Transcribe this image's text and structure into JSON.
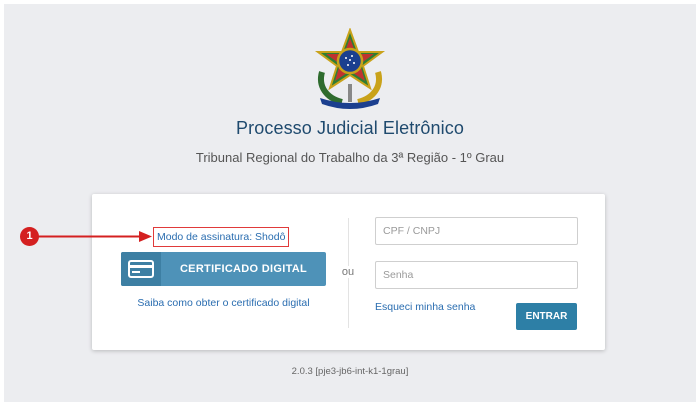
{
  "header": {
    "title": "Processo Judicial Eletrônico",
    "subtitle": "Tribunal Regional do Trabalho da 3ª Região - 1º Grau"
  },
  "certificate": {
    "mode_label": "Modo de assinatura: Shodô",
    "button_label": "CERTIFICADO DIGITAL",
    "help_link": "Saiba como obter o certificado digital"
  },
  "separator_text": "ou",
  "login": {
    "cpf_placeholder": "CPF / CNPJ",
    "password_placeholder": "Senha",
    "forgot_link": "Esqueci minha senha",
    "submit_label": "ENTRAR"
  },
  "footer": {
    "version": "2.0.3 [pje3-jb6-int-k1-1grau]"
  },
  "annotation": {
    "marker": "1",
    "color": "#d42020"
  },
  "colors": {
    "title": "#1f4a6e",
    "primary_button": "#4e92b8",
    "submit_button": "#2d7fa6",
    "link": "#2a6db0",
    "background": "#ecedf0"
  },
  "icons": {
    "emblem": "brazil-coat-of-arms-icon",
    "certificate": "id-card-icon"
  }
}
